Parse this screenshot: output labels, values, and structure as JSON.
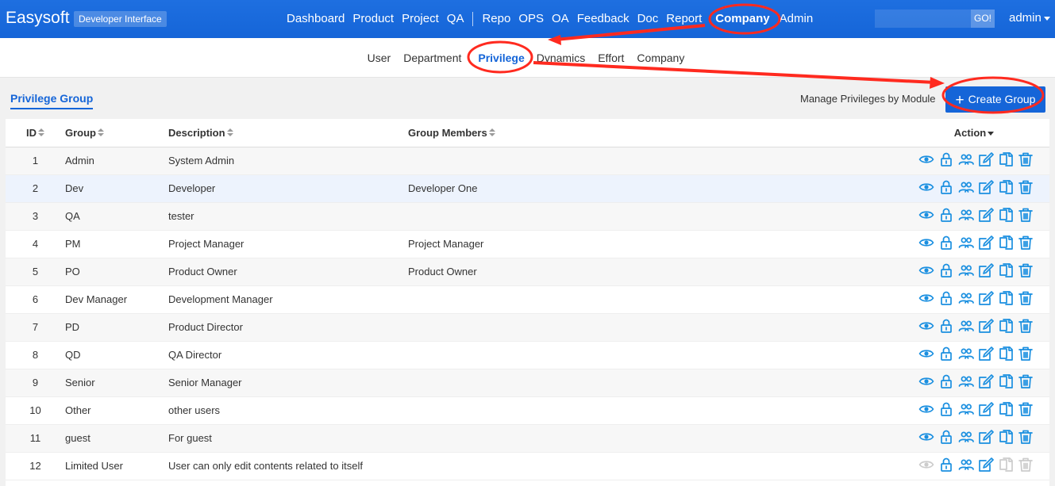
{
  "header": {
    "brand": "Easysoft",
    "badge": "Developer Interface",
    "nav": [
      "Dashboard",
      "Product",
      "Project",
      "QA",
      "Repo",
      "OPS",
      "OA",
      "Feedback",
      "Doc",
      "Report",
      "Company",
      "Admin"
    ],
    "active_nav": "Company",
    "search_placeholder": "",
    "search_button": "GO!",
    "user": "admin"
  },
  "subnav": {
    "items": [
      "User",
      "Department",
      "Privilege",
      "Dynamics",
      "Effort",
      "Company"
    ],
    "active": "Privilege"
  },
  "toolbar": {
    "tab": "Privilege Group",
    "manage_link": "Manage Privileges by Module",
    "create_button": "Create Group"
  },
  "table": {
    "columns": {
      "id": "ID",
      "group": "Group",
      "description": "Description",
      "members": "Group Members",
      "action": "Action"
    },
    "rows": [
      {
        "id": "1",
        "group": "Admin",
        "description": "System Admin",
        "members": ""
      },
      {
        "id": "2",
        "group": "Dev",
        "description": "Developer",
        "members": "Developer One"
      },
      {
        "id": "3",
        "group": "QA",
        "description": "tester",
        "members": ""
      },
      {
        "id": "4",
        "group": "PM",
        "description": "Project Manager",
        "members": "Project Manager"
      },
      {
        "id": "5",
        "group": "PO",
        "description": "Product Owner",
        "members": "Product Owner"
      },
      {
        "id": "6",
        "group": "Dev Manager",
        "description": "Development Manager",
        "members": ""
      },
      {
        "id": "7",
        "group": "PD",
        "description": "Product Director",
        "members": ""
      },
      {
        "id": "8",
        "group": "QD",
        "description": "QA Director",
        "members": ""
      },
      {
        "id": "9",
        "group": "Senior",
        "description": "Senior Manager",
        "members": ""
      },
      {
        "id": "10",
        "group": "Other",
        "description": "other users",
        "members": ""
      },
      {
        "id": "11",
        "group": "guest",
        "description": "For guest",
        "members": ""
      },
      {
        "id": "12",
        "group": "Limited User",
        "description": "User can only edit contents related to itself",
        "members": ""
      }
    ],
    "action_icons": [
      "view-icon",
      "lock-icon",
      "members-icon",
      "edit-icon",
      "copy-icon",
      "delete-icon"
    ]
  },
  "colors": {
    "primary": "#1565d8",
    "icon": "#1a8fe0",
    "icon_disabled": "#cccccc",
    "annotation": "#ff2a1f"
  }
}
